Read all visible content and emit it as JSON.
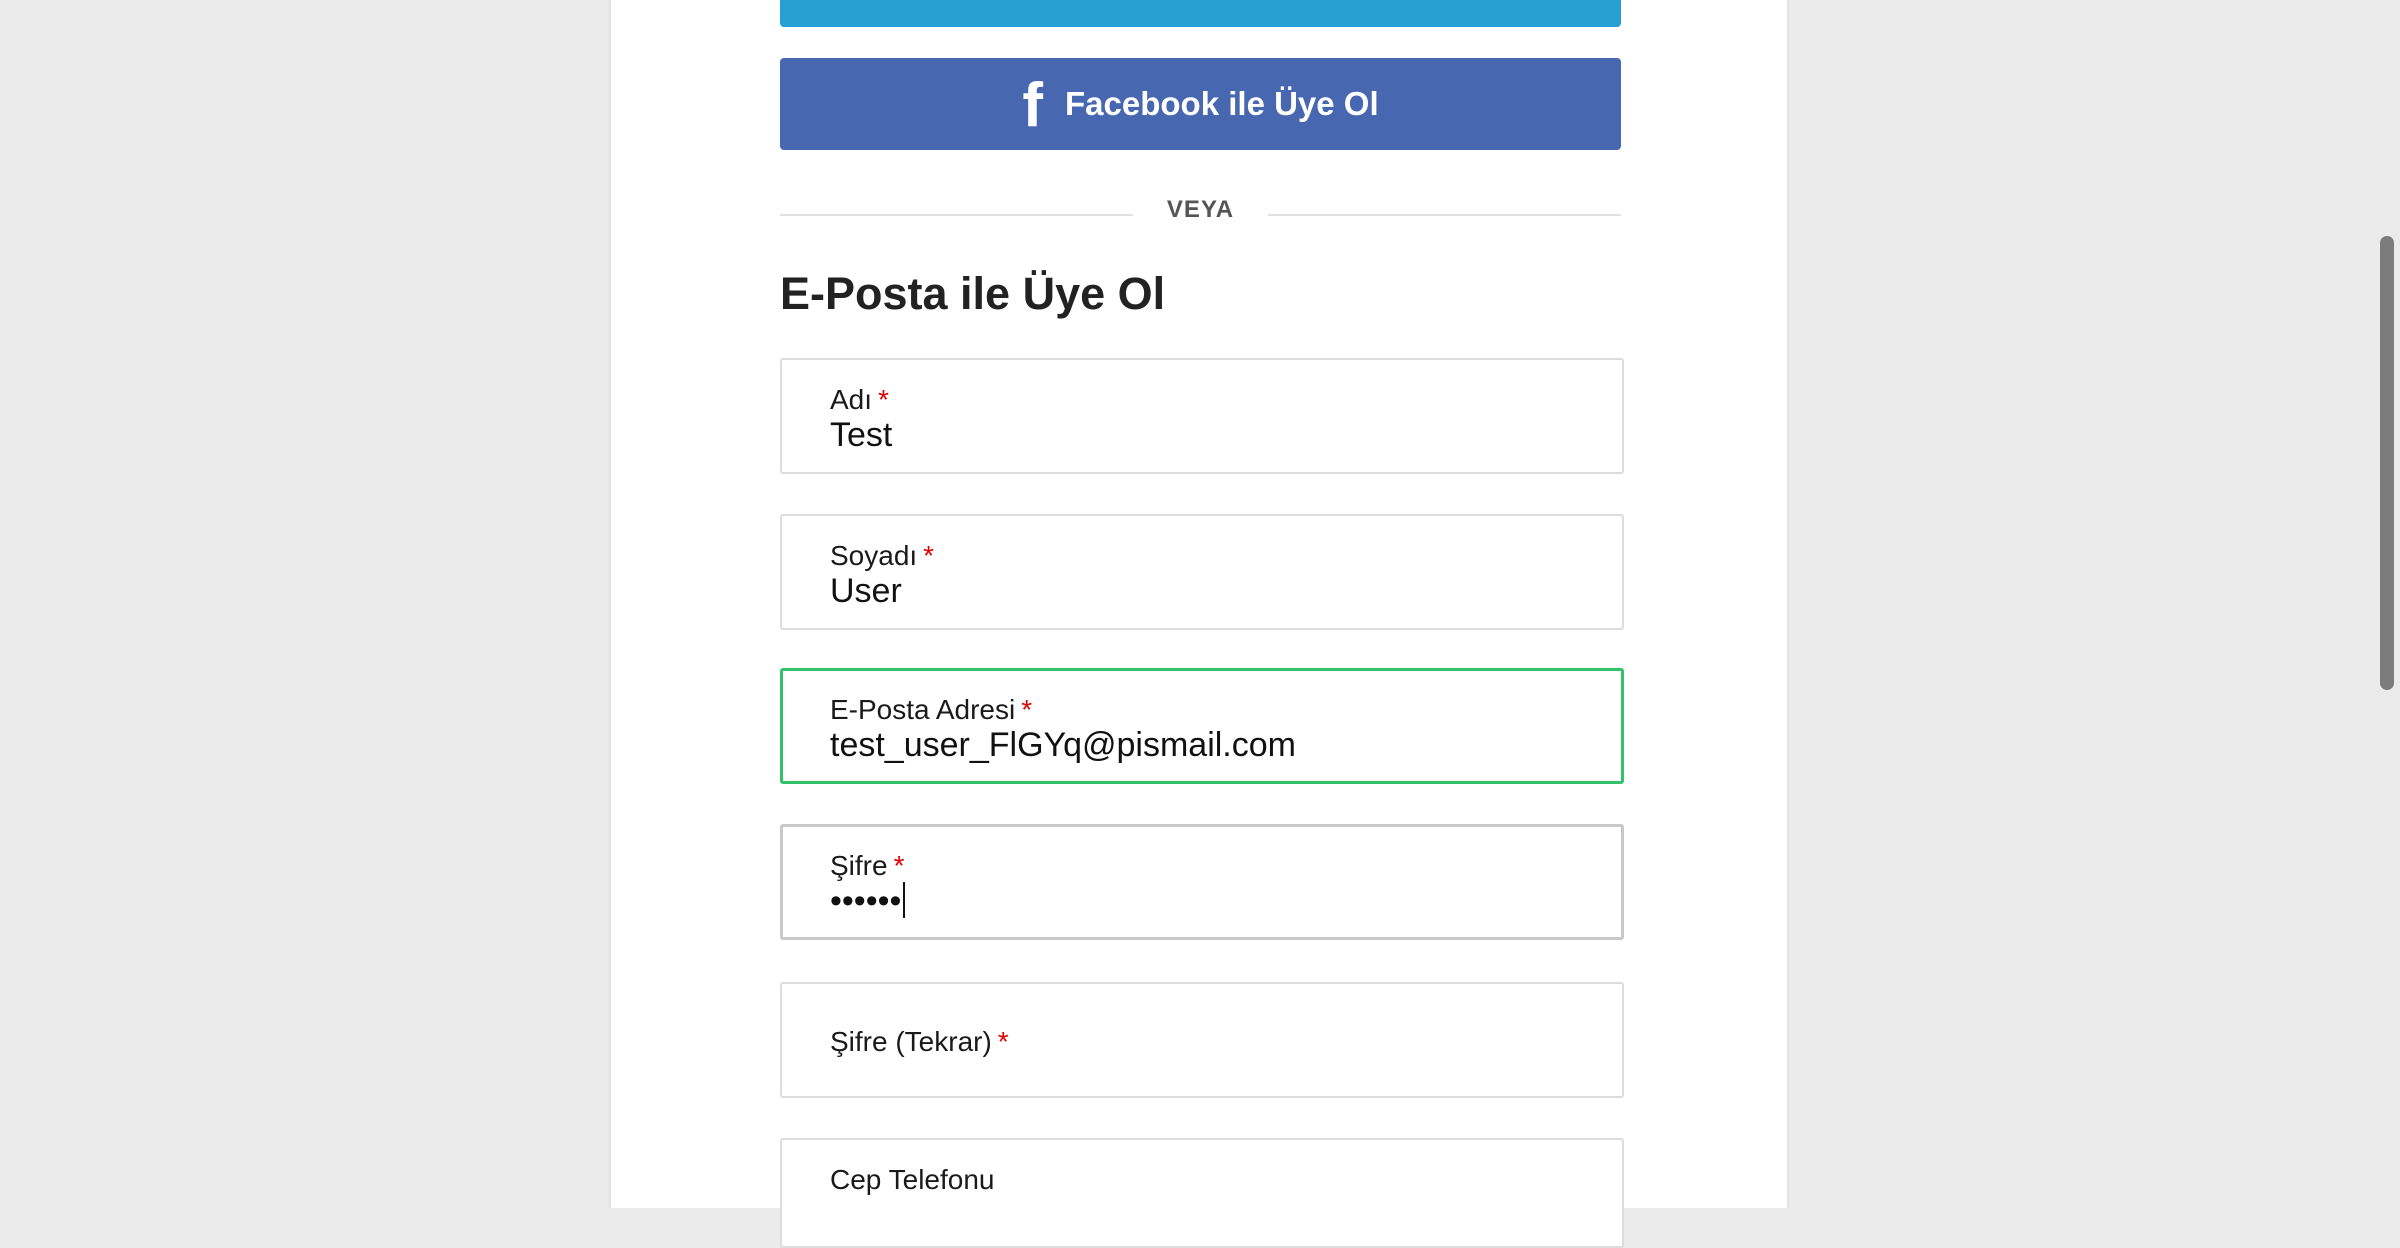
{
  "social": {
    "facebook_icon": "f",
    "facebook_label": "Facebook ile Üye Ol"
  },
  "divider": {
    "text": "VEYA"
  },
  "form": {
    "title": "E-Posta ile Üye Ol",
    "required_mark": "*",
    "first_name": {
      "label": "Adı",
      "value": "Test"
    },
    "last_name": {
      "label": "Soyadı",
      "value": "User"
    },
    "email": {
      "label": "E-Posta Adresi",
      "value": "test_user_FlGYq@pismail.com"
    },
    "password": {
      "label": "Şifre",
      "value": "••••••"
    },
    "password_repeat": {
      "label": "Şifre (Tekrar)",
      "value": ""
    },
    "phone": {
      "label": "Cep Telefonu",
      "value": ""
    }
  },
  "colors": {
    "facebook": "#4767b0",
    "top_button": "#26a0d0",
    "valid_border": "#33c16a",
    "required": "#e00000"
  }
}
